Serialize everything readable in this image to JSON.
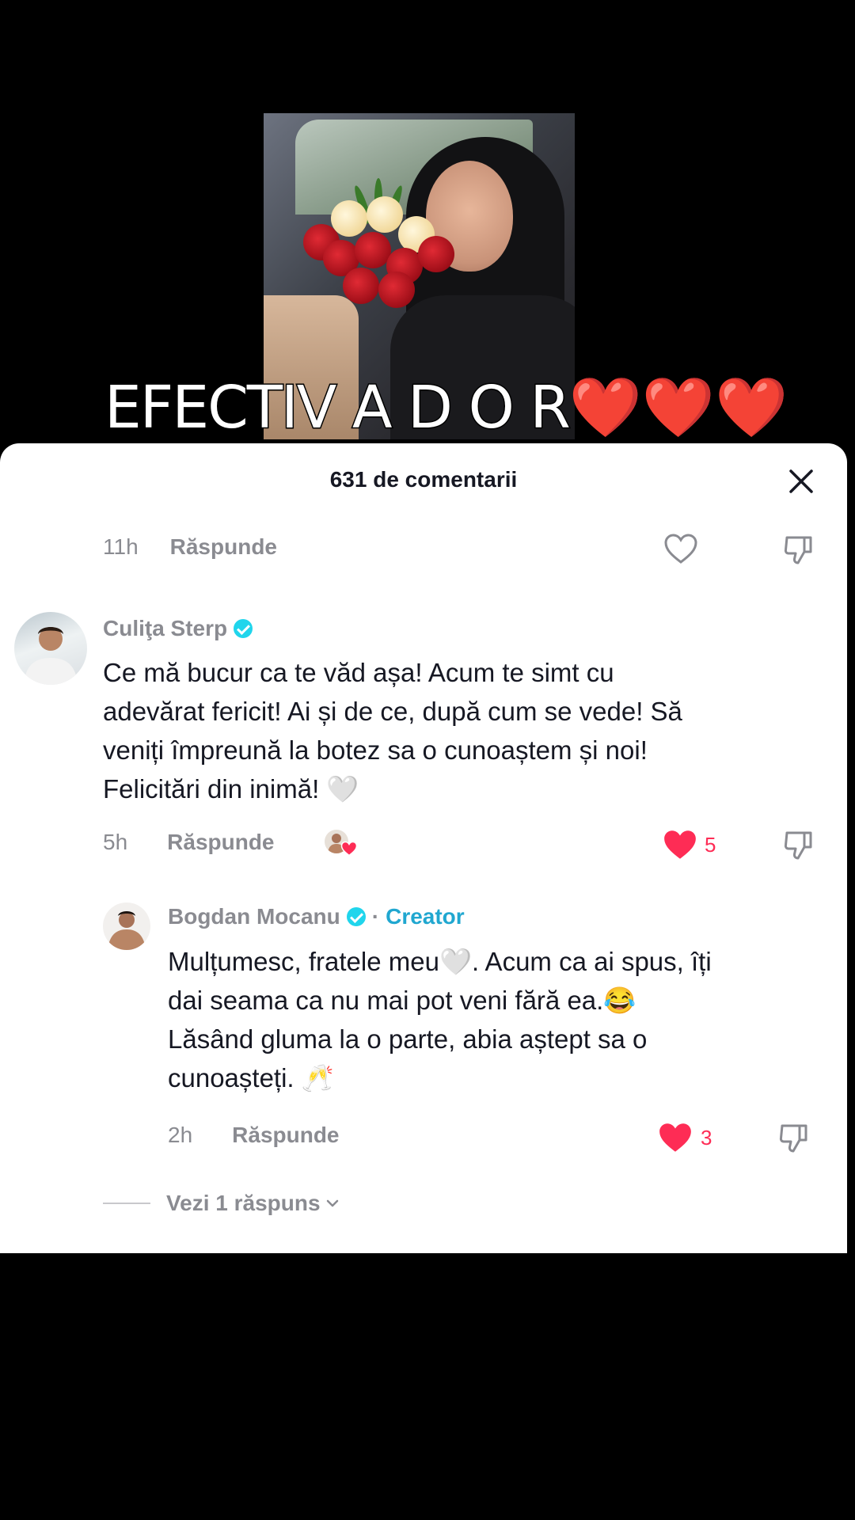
{
  "overlay": {
    "caption_text": "EFECTIV A D O R",
    "caption_hearts": "❤️❤️❤️"
  },
  "comments_sheet": {
    "title": "631 de comentarii",
    "close_icon": "close-icon"
  },
  "previous_comment": {
    "time": "11h",
    "reply_label": "Răspunde"
  },
  "comment_1": {
    "username": "Culiţa Sterp",
    "verified": true,
    "text_lines": [
      "Ce mă bucur ca te văd așa! Acum te simt cu",
      "adevărat fericit! Ai și de ce, după cum se vede! Să",
      "veniți împreună la botez sa o cunoaștem și noi!",
      "Felicitări din inimă! 🤍"
    ],
    "time": "5h",
    "reply_label": "Răspunde",
    "likes": "5",
    "liked": true
  },
  "reply_1": {
    "username": "Bogdan Mocanu",
    "verified": true,
    "separator": "·",
    "creator_label": "Creator",
    "text_lines": [
      "Mulțumesc, fratele meu🤍. Acum ca ai spus, îți",
      "dai seama ca nu mai pot veni fără ea.😂",
      "Lăsând gluma la o parte, abia aștept sa o",
      "cunoașteți. 🥂"
    ],
    "time": "2h",
    "reply_label": "Răspunde",
    "likes": "3",
    "liked": true
  },
  "view_replies": {
    "label": "Vezi 1 răspuns"
  },
  "colors": {
    "like_red": "#fe2c55",
    "verified_cyan": "#20d5ec",
    "creator_blue": "#20a7d0",
    "muted_gray": "#8a8b91",
    "text_dark": "#161823"
  }
}
